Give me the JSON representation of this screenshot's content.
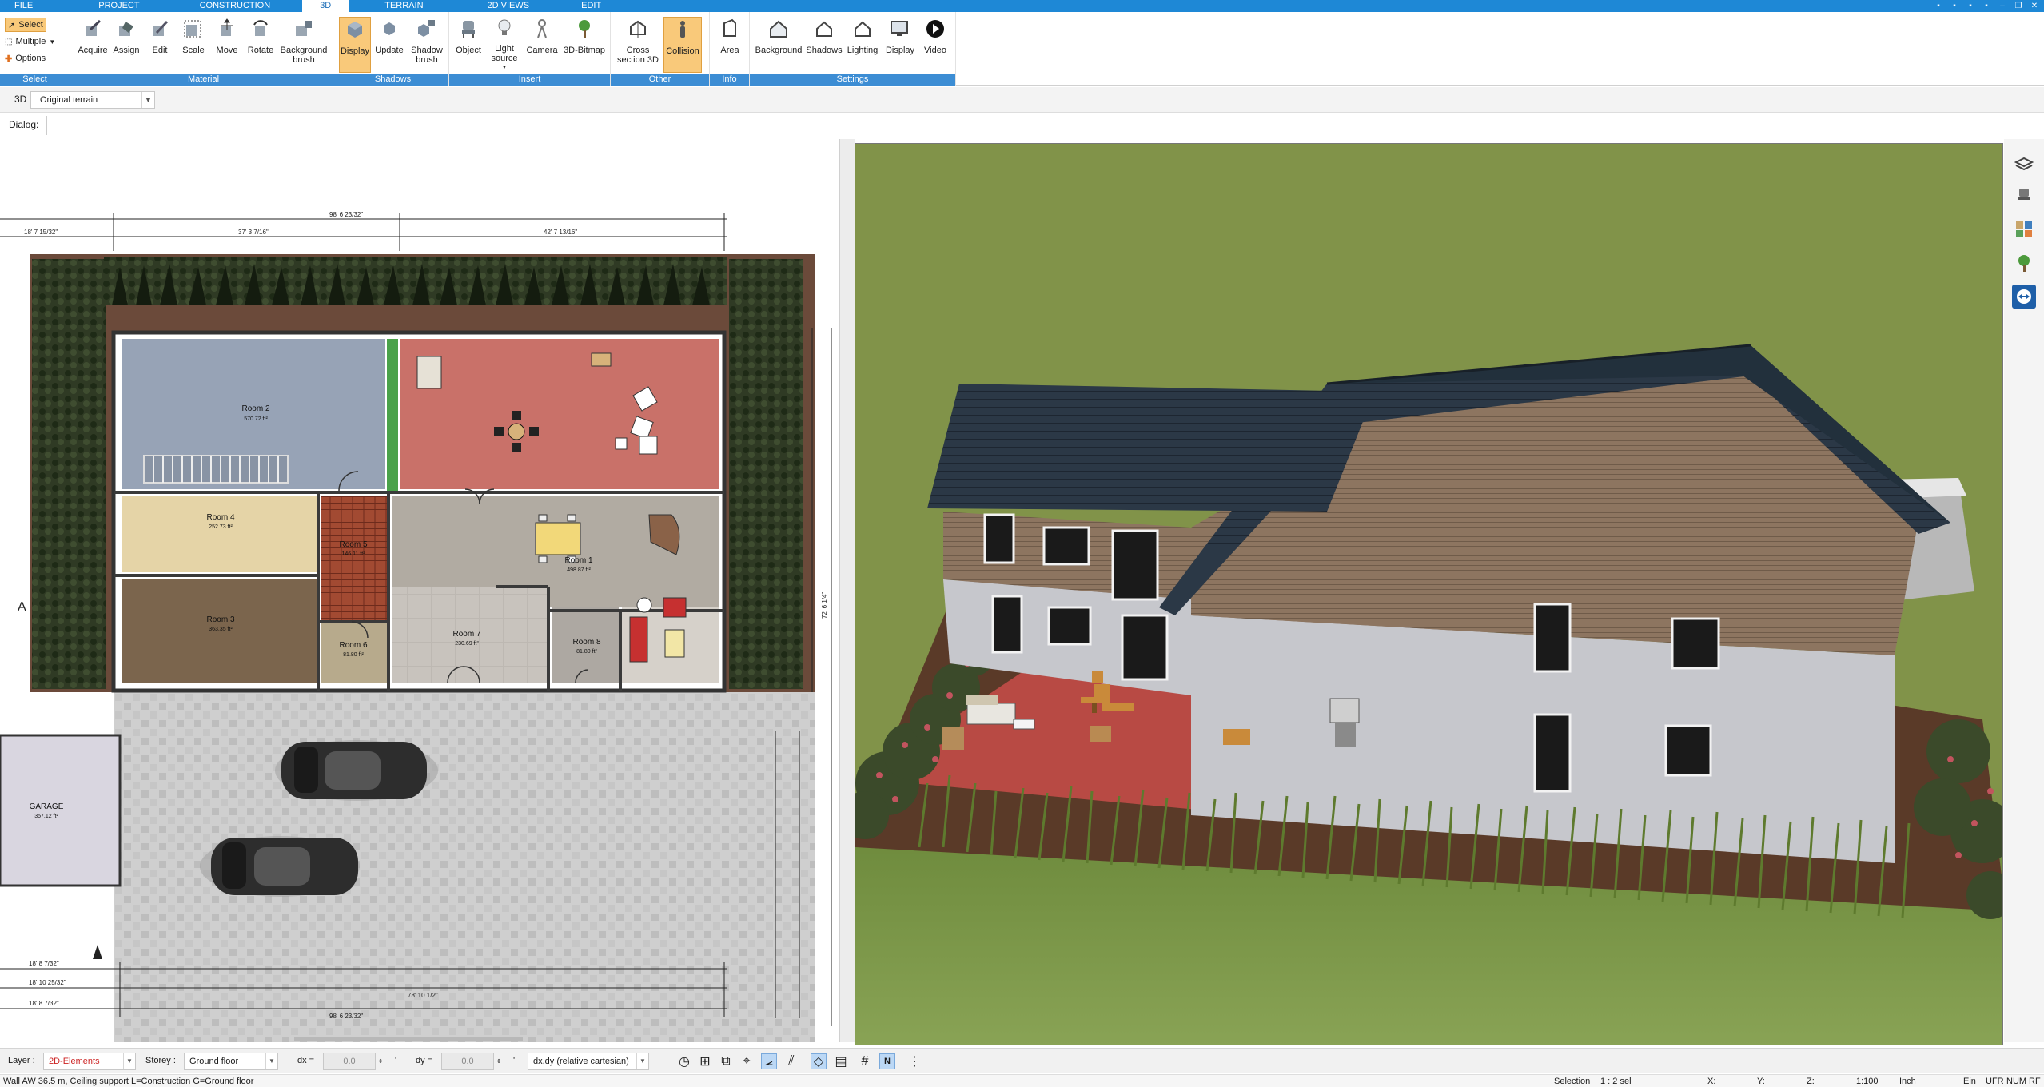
{
  "menu": {
    "tabs": [
      "FILE",
      "PROJECT",
      "CONSTRUCTION",
      "3D",
      "TERRAIN",
      "2D VIEWS",
      "EDIT"
    ],
    "active_tab": "3D"
  },
  "ribbon": {
    "select_group": {
      "select": "Select",
      "multiple": "Multiple",
      "options": "Options",
      "label": "Select"
    },
    "material_group": {
      "label": "Material",
      "buttons": [
        "Acquire",
        "Assign",
        "Edit",
        "Scale",
        "Move",
        "Rotate",
        "Background brush"
      ]
    },
    "shadows_group": {
      "label": "Shadows",
      "buttons": [
        "Display",
        "Update",
        "Shadow brush"
      ]
    },
    "insert_group": {
      "label": "Insert",
      "buttons": [
        "Object",
        "Light source",
        "Camera",
        "3D-Bitmap"
      ]
    },
    "other_group": {
      "label": "Other",
      "buttons": [
        "Cross section 3D",
        "Collision"
      ]
    },
    "info_group": {
      "label": "Info",
      "buttons": [
        "Area"
      ]
    },
    "settings_group": {
      "label": "Settings",
      "buttons": [
        "Background",
        "Shadows",
        "Lighting",
        "Display",
        "Video"
      ]
    }
  },
  "modebar": {
    "mode": "3D",
    "terrain": "Original terrain"
  },
  "dialog": {
    "label": "Dialog:"
  },
  "plan": {
    "rooms": [
      {
        "name": "Room 2",
        "area": "570.72 ft²"
      },
      {
        "name": "Room 4",
        "area": "252.73 ft²"
      },
      {
        "name": "Room 3",
        "area": "363.35 ft²"
      },
      {
        "name": "Room 5",
        "area": "146.11 ft²"
      },
      {
        "name": "Room 1",
        "area": "498.87 ft²"
      },
      {
        "name": "Room 6",
        "area": "81.80 ft²"
      },
      {
        "name": "Room 7",
        "area": "230.69 ft²"
      },
      {
        "name": "Room 8",
        "area": "81.80 ft²"
      },
      {
        "name": "GARAGE",
        "area": "357.12 ft²"
      }
    ],
    "dims": {
      "top_overall": "98' 6 23/32\"",
      "top_left": "18' 7 15/32\"",
      "top_mid": "37' 3 7/16\"",
      "top_right": "42' 7 13/16\"",
      "bottom_overall": "98' 6 23/32\"",
      "bottom_mid": "78' 10 1/2\"",
      "bottom_left": "18' 8 7/32\"",
      "bottom_left2": "18' 10 25/32\"",
      "bottom_left3": "18' 8 7/32\"",
      "right_v1": "72' 6 1/4\"",
      "left_marker": "A"
    }
  },
  "propbar": {
    "layer_label": "Layer :",
    "layer_value": "2D-Elements",
    "storey_label": "Storey :",
    "storey_value": "Ground floor",
    "dx_label": "dx =",
    "dx_value": "0.0",
    "dy_label": "dy =",
    "dy_value": "0.0",
    "coord_mode": "dx,dy (relative cartesian)"
  },
  "status": {
    "message": "Wall AW 36.5 m, Ceiling support L=Construction G=Ground floor",
    "selection_label": "Selection",
    "selection_value": "1 : 2 sel",
    "x_label": "X:",
    "y_label": "Y:",
    "z_label": "Z:",
    "scale": "1:100",
    "unit": "Inch",
    "mode1": "Ein",
    "mode2": "UFR",
    "mode3": "NUM",
    "mode4": "RF"
  },
  "colors": {
    "accent": "#1e88d6",
    "ribbon_label": "#3c8dd4",
    "active_button": "#f9c97a",
    "layer_text": "#cc2222",
    "grass": "#819349",
    "roof": "#2b3846",
    "patio": "#b84a44"
  }
}
